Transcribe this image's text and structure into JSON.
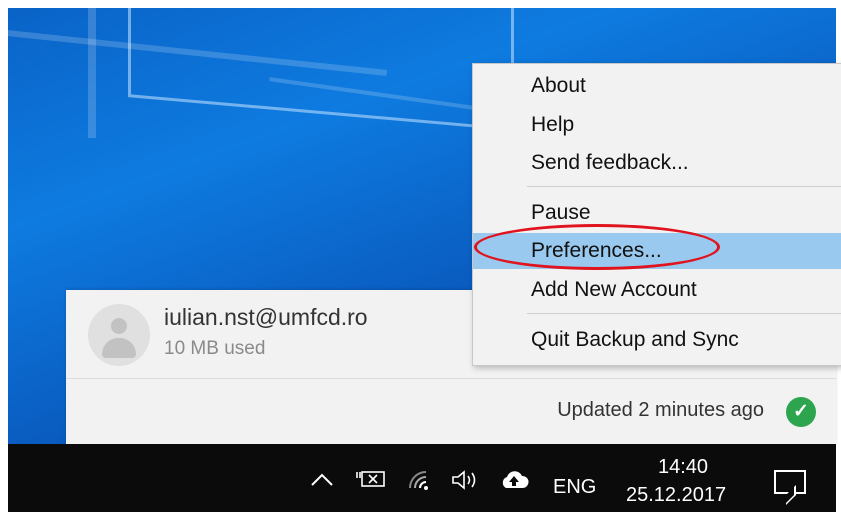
{
  "account": {
    "email": "iulian.nst@umfcd.ro",
    "usage": "10 MB used"
  },
  "status": {
    "text": "Updated 2 minutes ago",
    "icon": "check-circle-icon",
    "color": "#2da44e"
  },
  "menu": {
    "items": [
      {
        "label": "About"
      },
      {
        "label": "Help"
      },
      {
        "label": "Send feedback..."
      },
      {
        "label": "Pause"
      },
      {
        "label": "Preferences...",
        "highlighted": true
      },
      {
        "label": "Add New Account"
      },
      {
        "label": "Quit Backup and Sync"
      }
    ],
    "highlight_color": "#99c9ef",
    "annotation_color": "#e0141e"
  },
  "taskbar": {
    "icons": [
      "chevron-up-icon",
      "battery-icon",
      "wifi-icon",
      "volume-icon",
      "cloud-upload-icon"
    ],
    "language": "ENG",
    "time": "14:40",
    "date": "25.12.2017",
    "notification_icon": "action-center-icon"
  },
  "colors": {
    "desktop": "#0e7be0",
    "taskbar": "#0b0b0b"
  }
}
